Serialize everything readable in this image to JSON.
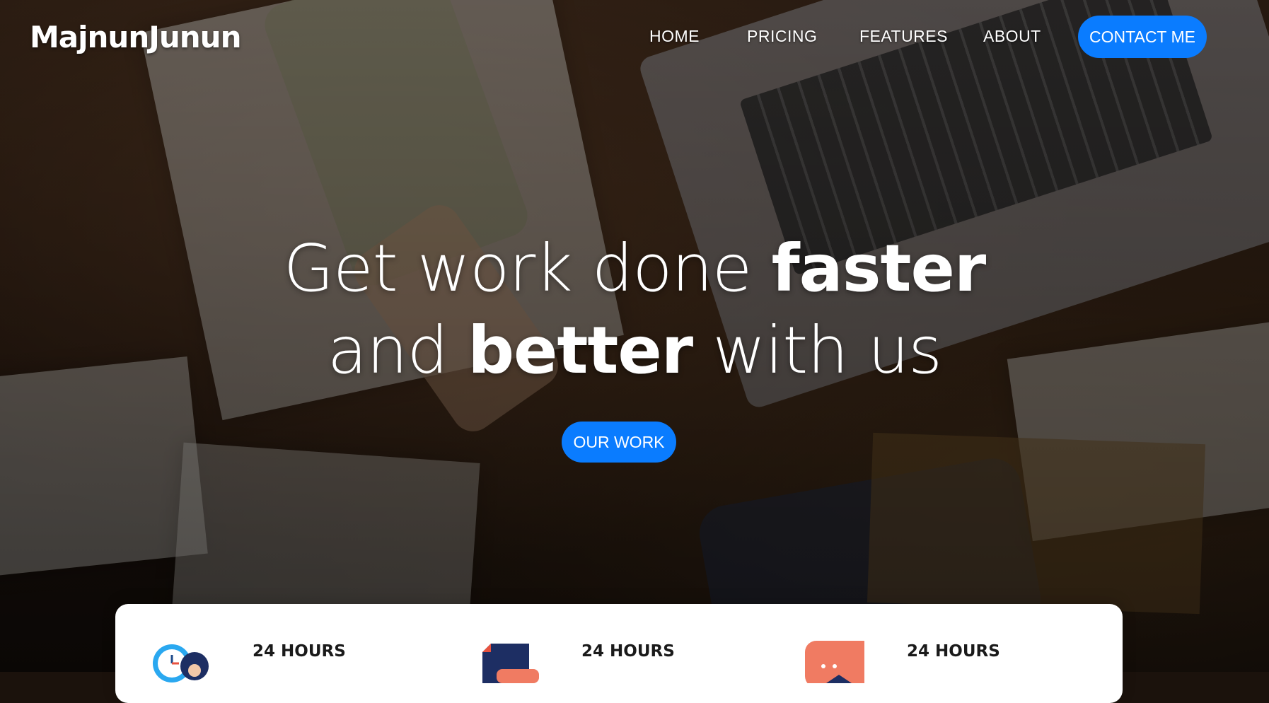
{
  "brand": {
    "name": "MajnunJunun"
  },
  "nav": {
    "links": [
      "HOME",
      "PRICING",
      "FEATURES",
      "ABOUT"
    ],
    "cta_label": "CONTACT ME"
  },
  "hero": {
    "line1_prefix": "Get work done ",
    "line1_bold": "faster",
    "line2_prefix": "and ",
    "line2_bold": "better",
    "line2_suffix": " with us",
    "button_label": "OUR WORK"
  },
  "features": [
    {
      "title": "24 HOURS",
      "icon": "clock-user-icon"
    },
    {
      "title": "24 HOURS",
      "icon": "document-icon"
    },
    {
      "title": "24 HOURS",
      "icon": "chat-icon"
    }
  ],
  "colors": {
    "accent": "#0a7cff",
    "card_bg": "#ffffff"
  }
}
